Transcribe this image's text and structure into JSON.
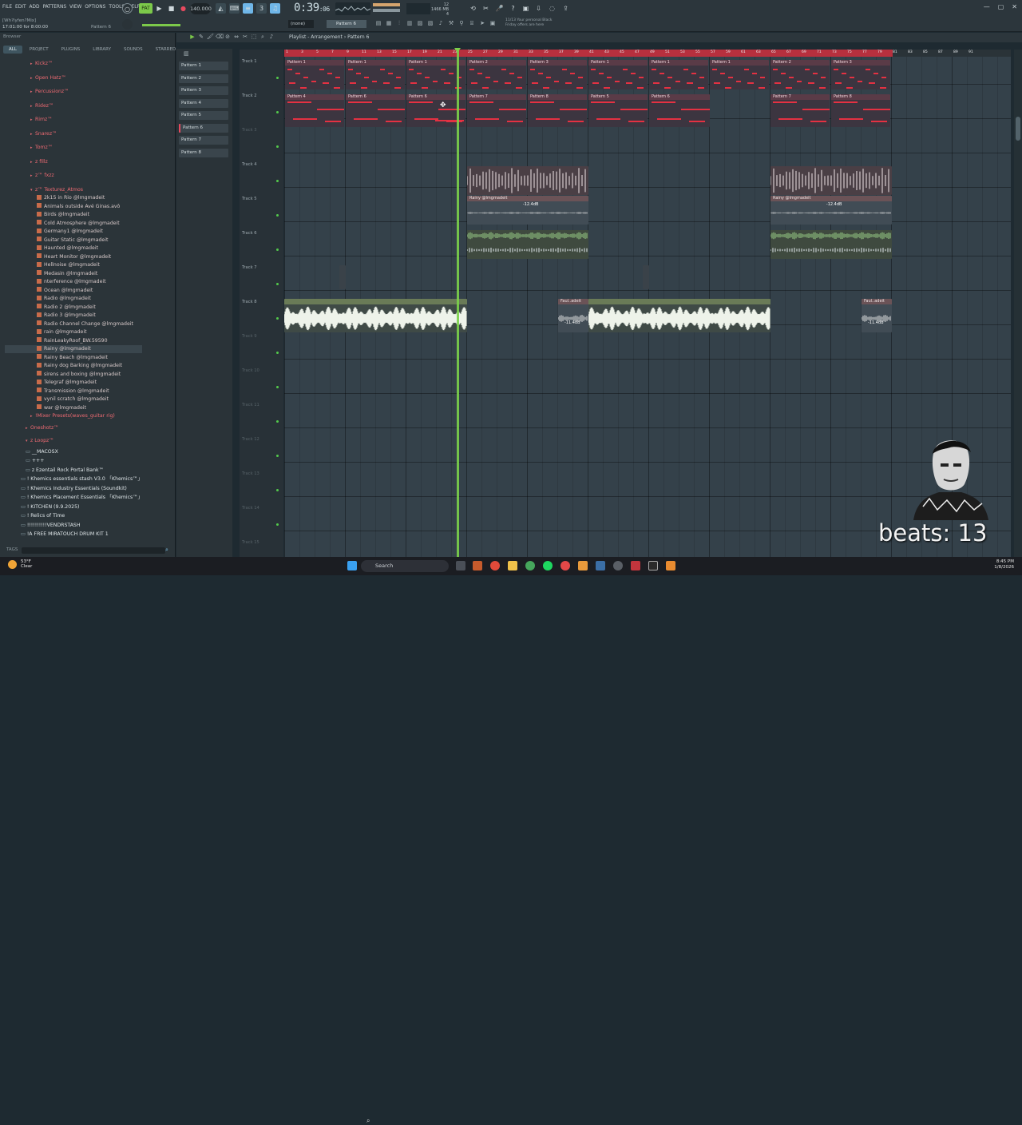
{
  "menu": [
    "FILE",
    "EDIT",
    "ADD",
    "PATTERNS",
    "VIEW",
    "OPTIONS",
    "TOOLS",
    "HELP"
  ],
  "song_position": "17:01:00 for 8:00:00",
  "hint_line_small": "[Wh?lyfen?Mix]",
  "pattern_label": "Pattern 6",
  "tempo": "140.000",
  "time": "0:39",
  "time_small": ":06",
  "cpu": "12",
  "ram": "1466 MB",
  "voices": "4",
  "hint_top": "11/13  Your personal Black",
  "hint_bottom": "Friday offers are here",
  "mode": "(none)",
  "pattern_selector": "Pattern 6",
  "browser": {
    "title": "Browser",
    "tabs": [
      "ALL",
      "PROJECT",
      "PLUGINS",
      "LIBRARY",
      "SOUNDS",
      "STARRED"
    ],
    "folders_red": [
      "Kickz™",
      "Open Hatz™",
      "Percussionz™",
      "Ridez™",
      "Rimz™",
      "Snarez™",
      "Tomz™",
      "z fillz",
      "z™ fxzz",
      "z™ Texturez_Atmos"
    ],
    "files": [
      "2k15 in Rio @lmgmadeit",
      "Animals outside Avé Ginas.avô",
      "Birds @lmgmadeit",
      "Cold Atmosphere @lmgmadeit",
      "Germany1 @lmgmadeit",
      "Guitar Static @lmgmadeit",
      "Haunted @lmgmadeit",
      "Heart Monitor @lmgmadeit",
      "Hellnoise @lmgmadeit",
      "Medasin @lmgmadeit",
      "nterference @lmgmadeit",
      "Ocean @lmgmadeit",
      "Radio @lmgmadeit",
      "Radio 2 @lmgmadeit",
      "Radio 3 @lmgmadeit",
      "Radio Channel Change @lmgmadeit",
      "rain @lmgmadeit",
      "RainLeakyRoof_BW.59590",
      "Rainy @lmgmadeit",
      "Rainy Beach @lmgmadeit",
      "Rainy dog Barking @lmgmadeit",
      "sirens and boxing @lmgmadeit",
      "Telegraf @lmgmadeit",
      "Transmission @lmgmadeit",
      "vynil scratch @lmgmadeit",
      "war @lmgmadeit"
    ],
    "folders_after": [
      "!Mixer Presets(waves_guitar rig)",
      "Oneshotz™",
      "z Loopz™"
    ],
    "root_items": [
      "__MACOSX",
      "+++",
      "z Ezentail Rock Portal Bank™",
      "! Khemics essentials stash V3.0 「Khemics™」",
      "! Khemics Industry Essentials (Soundkit)",
      "! Khemics Placement Essentials 「Khemics™」",
      "! KITCHEN (9.9.2025)",
      "! Relics of Time",
      "!!!!!!!!!!VENDRSTASH",
      "!A FREE MIRATOUCH DRUM KIT 1"
    ],
    "tags_label": "TAGS"
  },
  "patterns": [
    "Pattern 1",
    "Pattern 2",
    "Pattern 3",
    "Pattern 4",
    "Pattern 5",
    "Pattern 6",
    "Pattern 7",
    "Pattern 8"
  ],
  "playlist": {
    "title": "Playlist - Arrangement › Pattern 6",
    "tracks": [
      "Track 1",
      "Track 2",
      "Track 3",
      "Track 4",
      "Track 5",
      "Track 6",
      "Track 7",
      "Track 8",
      "Track 9",
      "Track 10",
      "Track 11",
      "Track 12",
      "Track 13",
      "Track 14",
      "Track 15"
    ],
    "ruler": [
      "1",
      "3",
      "5",
      "7",
      "9",
      "11",
      "13",
      "15",
      "17",
      "19",
      "21",
      "23",
      "25",
      "27",
      "29",
      "31",
      "33",
      "35",
      "37",
      "39",
      "41",
      "43",
      "45",
      "47",
      "49",
      "51",
      "53",
      "55",
      "57",
      "59",
      "61",
      "63",
      "65",
      "67",
      "69",
      "71",
      "73",
      "75",
      "77",
      "79",
      "81",
      "83",
      "85",
      "87",
      "89",
      "91"
    ],
    "row1_clips": [
      "Pattern 1",
      "Pattern 1",
      "Pattern 1",
      "Pattern 2",
      "Pattern 3",
      "Pattern 1",
      "Pattern 1",
      "Pattern 1",
      "Pattern 2",
      "Pattern 3"
    ],
    "row2_clips": [
      "Pattern 4",
      "Pattern 6",
      "Pattern 6",
      "Pattern 7",
      "Pattern 8",
      "Pattern 5",
      "Pattern 6",
      "Pattern 7",
      "Pattern 8"
    ],
    "rainy_clip": "Rainy @lmgmadeit",
    "rainy_db": "-12.4dB",
    "faul_clip": "Faul..adeit",
    "faul_db": "-11.4dB"
  },
  "taskbar": {
    "weather_temp": "53°F",
    "weather_text": "Clear",
    "search": "Search",
    "time": "8:45 PM",
    "date": "1/8/2026"
  },
  "overlay": {
    "beats": "beats: 13"
  }
}
